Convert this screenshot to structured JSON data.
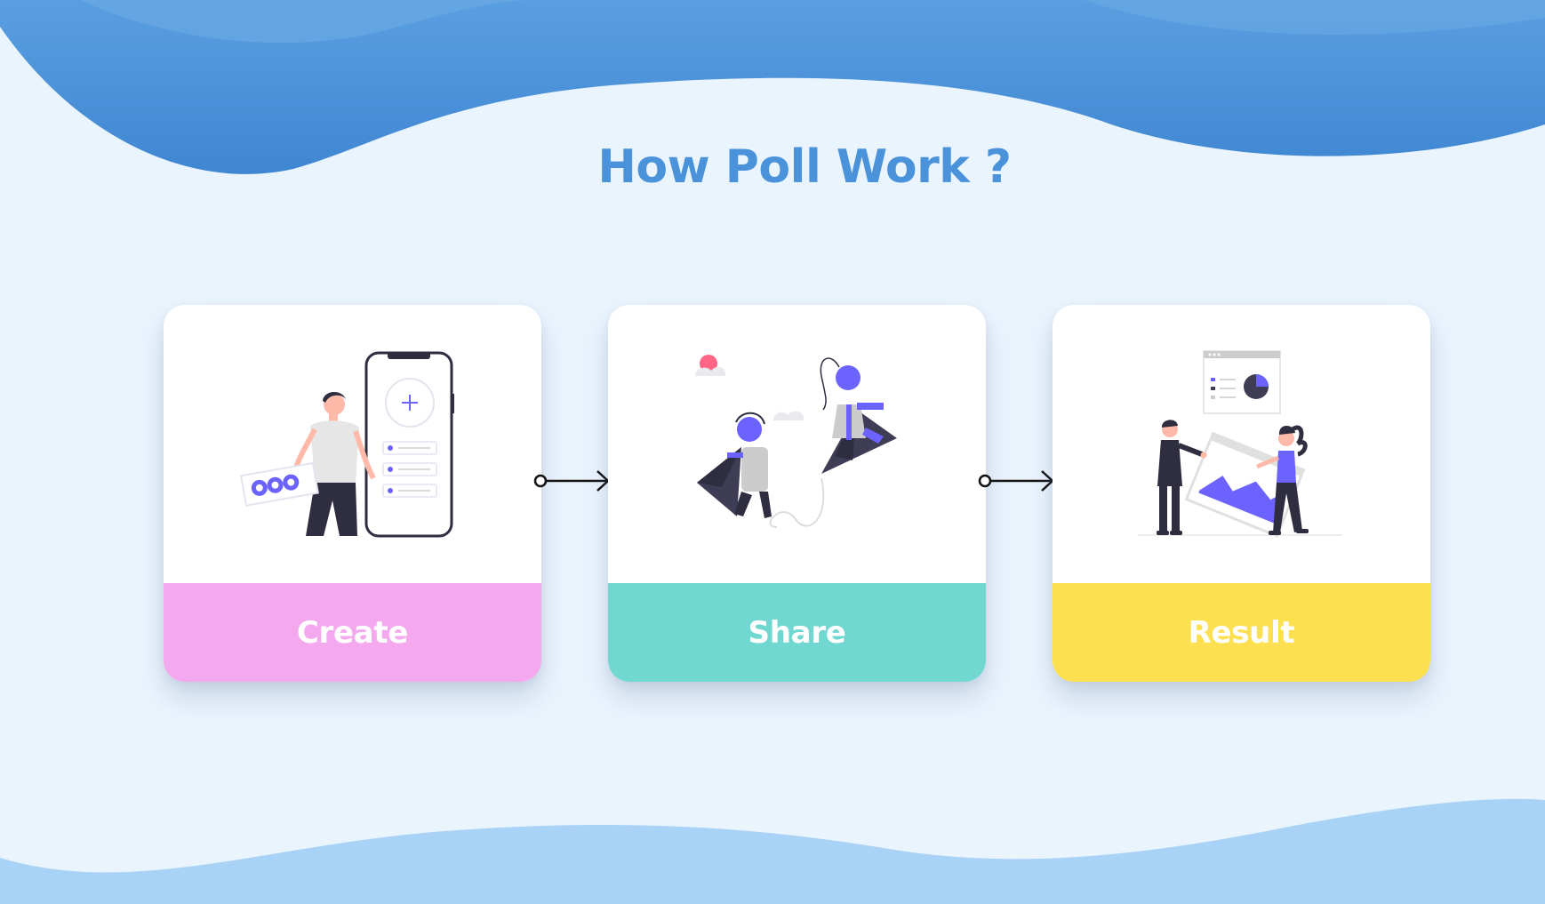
{
  "title": "How Poll Work ?",
  "colors": {
    "background": "#eaf4fd",
    "title": "#4a93db",
    "wave_top": "#4f95db",
    "wave_bottom": "#a9d2f7",
    "accent_purple": "#6c63ff",
    "dark_figure": "#2f2e41"
  },
  "steps": [
    {
      "label": "Create",
      "band_color": "#f4a8ee",
      "icon": "person-phone-illustration"
    },
    {
      "label": "Share",
      "band_color": "#70d8d0",
      "icon": "paper-plane-illustration"
    },
    {
      "label": "Result",
      "band_color": "#fde050",
      "icon": "chart-presentation-illustration"
    }
  ]
}
